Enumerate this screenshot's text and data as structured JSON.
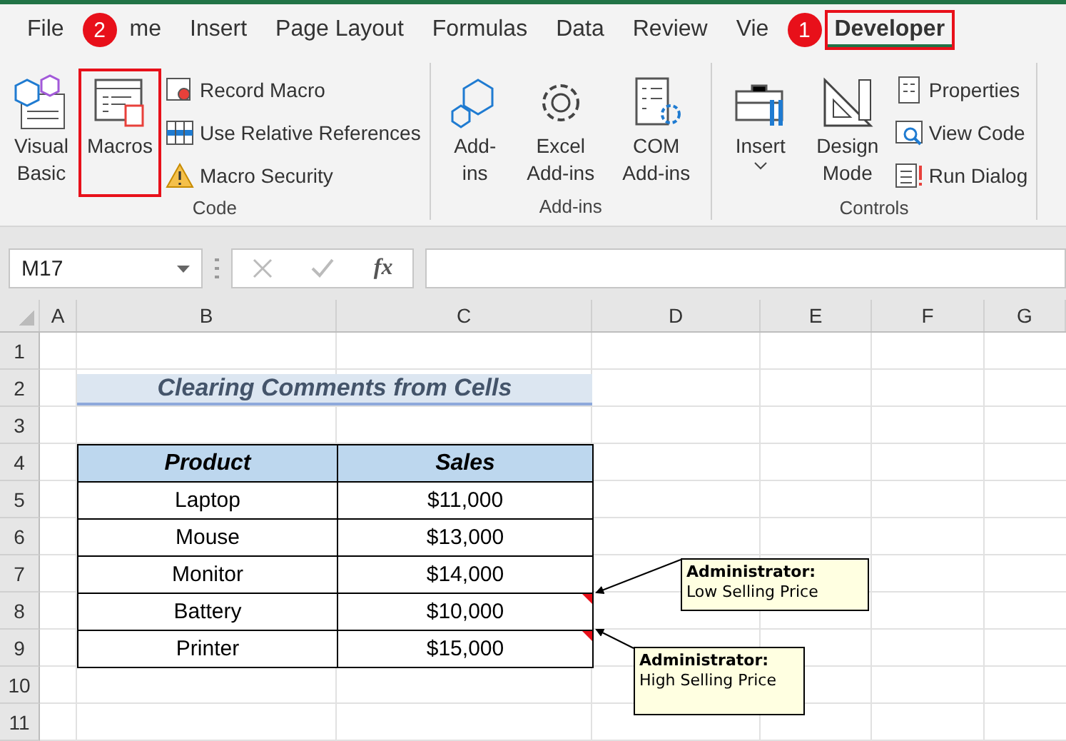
{
  "tabs": [
    {
      "label": "File",
      "selected": false
    },
    {
      "label": "me",
      "selected": false,
      "badge": "2"
    },
    {
      "label": "Insert",
      "selected": false
    },
    {
      "label": "Page Layout",
      "selected": false
    },
    {
      "label": "Formulas",
      "selected": false
    },
    {
      "label": "Data",
      "selected": false
    },
    {
      "label": "Review",
      "selected": false
    },
    {
      "label": "Vie",
      "selected": false
    },
    {
      "label": "Developer",
      "selected": true,
      "badge": "1",
      "highlighted": true
    }
  ],
  "ribbon": [
    {
      "label": "Code",
      "large": [
        {
          "label": "Visual Basic",
          "highlighted": false
        },
        {
          "label": "Macros",
          "highlighted": true
        }
      ],
      "small": [
        "Record Macro",
        "Use Relative References",
        "Macro Security"
      ]
    },
    {
      "label": "Add-ins",
      "large": [
        {
          "label": "Add-ins",
          "highlighted": false
        },
        {
          "label": "Excel Add-ins",
          "highlighted": false
        },
        {
          "label": "COM Add-ins",
          "highlighted": false
        }
      ]
    },
    {
      "label": "Controls",
      "large": [
        {
          "label": "Insert",
          "highlighted": false,
          "dropdown": true
        },
        {
          "label": "Design Mode",
          "highlighted": false,
          "dropdown": false
        }
      ],
      "small": [
        "Properties",
        "View Code",
        "Run Dialog"
      ]
    }
  ],
  "formula_bar": {
    "name_box": "M17",
    "function_label": "fx"
  },
  "sheet": {
    "columns": [
      "A",
      "B",
      "C",
      "D",
      "E",
      "F",
      "G"
    ],
    "rows": [
      "1",
      "2",
      "3",
      "4",
      "5",
      "6",
      "7",
      "8",
      "9",
      "10",
      "11"
    ],
    "title": "Clearing Comments from Cells",
    "table": {
      "header": [
        "Product",
        "Sales"
      ],
      "rows": [
        {
          "cells": [
            "Laptop",
            "$11,000"
          ]
        },
        {
          "cells": [
            "Mouse",
            "$13,000"
          ]
        },
        {
          "cells": [
            "Monitor",
            "$14,000"
          ]
        },
        {
          "cells": [
            "Battery",
            "$10,000"
          ],
          "comment": {
            "author": "Administrator:",
            "text": "Low Selling Price"
          }
        },
        {
          "cells": [
            "Printer",
            "$15,000"
          ],
          "comment": {
            "author": "Administrator:",
            "text": "High Selling Price"
          }
        }
      ]
    }
  }
}
